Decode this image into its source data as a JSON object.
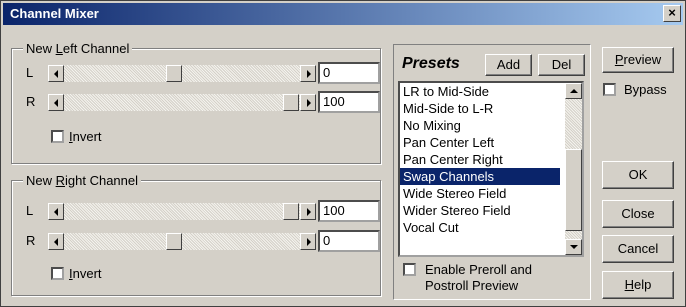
{
  "window": {
    "title": "Channel Mixer",
    "close_glyph": "×"
  },
  "left_group": {
    "title_prefix": "New ",
    "title_hotkey": "L",
    "title_suffix": "eft Channel",
    "rows": [
      {
        "label": "L",
        "value": "0",
        "level": 0.5
      },
      {
        "label": "R",
        "value": "100",
        "level": 1.0
      }
    ],
    "invert_hotkey": "I",
    "invert_rest": "nvert",
    "invert_checked": false
  },
  "right_group": {
    "title_prefix": "New ",
    "title_hotkey": "R",
    "title_suffix": "ight Channel",
    "rows": [
      {
        "label": "L",
        "value": "100",
        "level": 1.0
      },
      {
        "label": "R",
        "value": "0",
        "level": 0.5
      }
    ],
    "invert_hotkey": "I",
    "invert_rest": "nvert",
    "invert_checked": false
  },
  "presets": {
    "title": "Presets",
    "add_label": "Add",
    "del_label": "Del",
    "items": [
      "LR to Mid-Side",
      "Mid-Side to L-R",
      "No Mixing",
      "Pan Center Left",
      "Pan Center Right",
      "Swap Channels",
      "Wide Stereo Field",
      "Wider Stereo Field",
      "Vocal Cut"
    ],
    "selected": "Swap Channels",
    "preroll_line1": "Enable Preroll and",
    "preroll_line2": "Postroll Preview",
    "preroll_checked": false
  },
  "side": {
    "preview_hotkey": "P",
    "preview_rest": "review",
    "bypass_label": "Bypass",
    "bypass_checked": false,
    "ok_label": "OK",
    "close_label": "Close",
    "cancel_label": "Cancel",
    "help_hotkey": "H",
    "help_rest": "elp"
  },
  "icons": {
    "scroll_left": "scroll-left-arrow-icon",
    "scroll_right": "scroll-right-arrow-icon",
    "scroll_up": "scroll-up-arrow-icon",
    "scroll_down": "scroll-down-arrow-icon",
    "close": "close-icon"
  },
  "colors": {
    "titlebar_start": "#0a246a",
    "titlebar_end": "#a6caf0",
    "face": "#d4d0c8",
    "selection": "#0a246a"
  }
}
